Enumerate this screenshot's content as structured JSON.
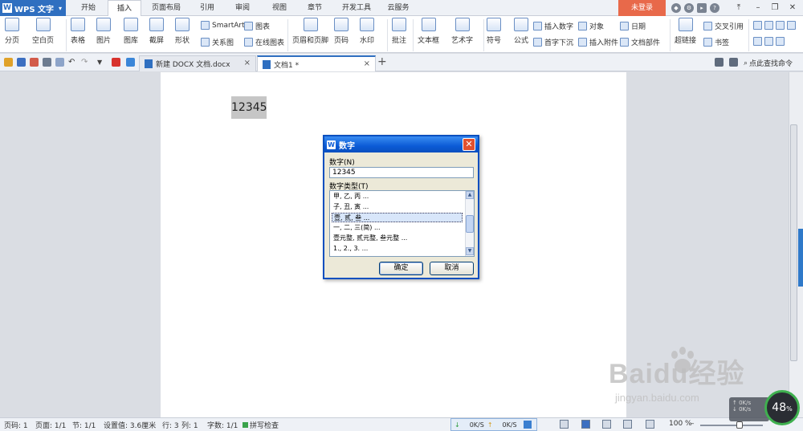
{
  "app": {
    "name": "WPS 文字"
  },
  "menu_tabs": [
    "开始",
    "插入",
    "页面布局",
    "引用",
    "审阅",
    "视图",
    "章节",
    "开发工具",
    "云服务"
  ],
  "active_menu_tab": "插入",
  "login_button": "未登录",
  "ribbon": {
    "page_break": "分页",
    "blank_page": "空白页",
    "table": "表格",
    "picture": "图片",
    "gallery": "图库",
    "screenshot": "截屏",
    "shape": "形状",
    "smartart": "SmartArt",
    "chart": "图表",
    "relation_chart": "关系图",
    "online_chart": "在线图表",
    "header_footer": "页眉和页脚",
    "page_number": "页码",
    "watermark": "水印",
    "comment": "批注",
    "text_box": "文本框",
    "art_text": "艺术字",
    "symbol": "符号",
    "formula": "公式",
    "insert_number": "插入数字",
    "object": "对象",
    "date": "日期",
    "drop_cap": "首字下沉",
    "insert_attachment": "插入附件",
    "doc_parts": "文档部件",
    "hyperlink": "超链接",
    "cross_reference": "交叉引用",
    "bookmark": "书签"
  },
  "doc_tabs": [
    {
      "label": "新建 DOCX 文档.docx",
      "active": false
    },
    {
      "label": "文档1 *",
      "active": true
    }
  ],
  "find_command": "点此查找命令",
  "document": {
    "content": "12345"
  },
  "dialog": {
    "title": "数字",
    "number_label": "数字(N)",
    "number_value": "12345",
    "type_label": "数字类型(T)",
    "types": [
      "甲, 乙, 丙 ...",
      "子, 丑, 寅 ...",
      "壹, 贰, 叁 ...",
      "一, 二, 三(简) ...",
      "壹元整, 贰元整, 叁元整 ...",
      "1., 2., 3. ..."
    ],
    "selected_type": "壹, 贰, 叁 ...",
    "ok": "确定",
    "cancel": "取消"
  },
  "status": {
    "page": "页码: 1",
    "pages": "页面: 1/1",
    "section": "节: 1/1",
    "setting": "设置值: 3.6厘米",
    "row": "行: 3",
    "column": "列: 1",
    "words": "字数: 1/1",
    "spell_check": "拼写检查",
    "download_speed": "0K/S",
    "upload_speed": "0K/S",
    "zoom": "100 %"
  },
  "speed_widget": {
    "percent": "48",
    "percent_sign": "%",
    "up": "0K/s",
    "down": "0K/s"
  },
  "watermark": {
    "brand": "Baidu经验",
    "url": "jingyan.baidu.com"
  }
}
